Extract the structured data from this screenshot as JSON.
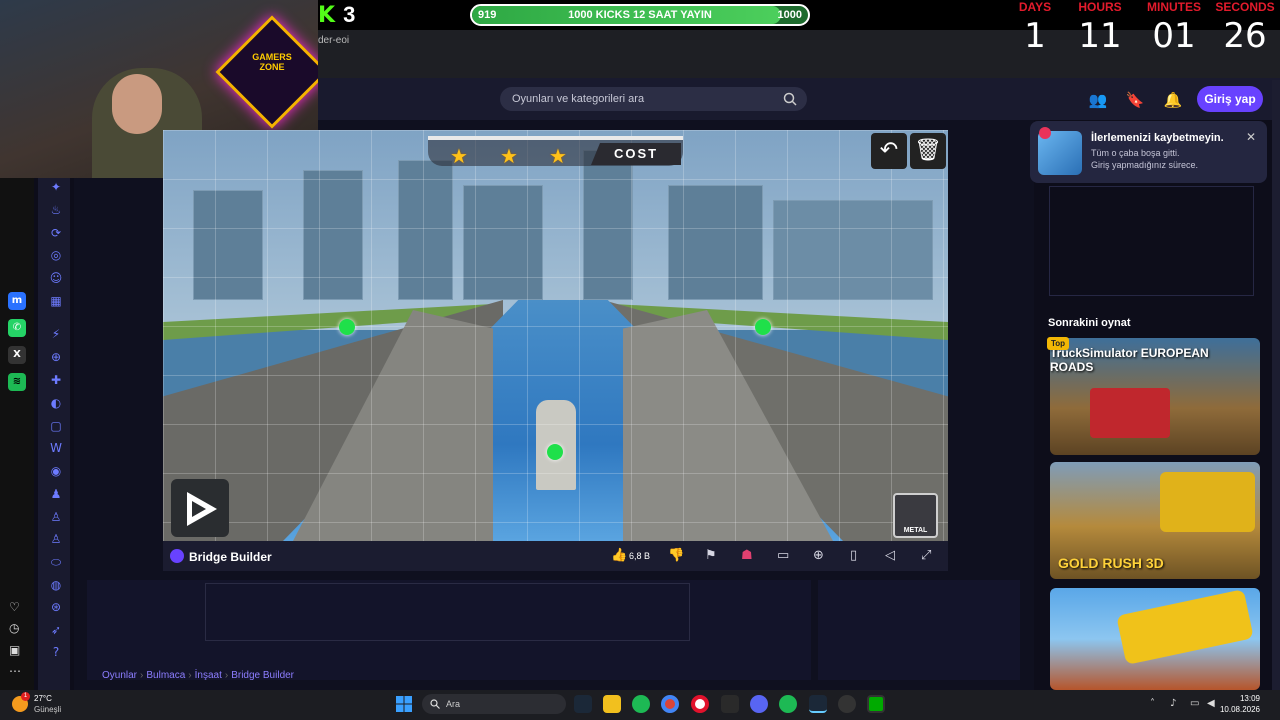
{
  "stream": {
    "kick_count": "3",
    "goal": {
      "current": "919",
      "title": "1000 KICKS 12 SAAT YAYIN",
      "max": "1000",
      "progress": 0.919
    },
    "countdown": {
      "days_label": "DAYS",
      "days": "1",
      "hours_label": "HOURS",
      "hours": "11",
      "minutes_label": "MINUTES",
      "minutes": "01",
      "seconds_label": "SECONDS",
      "seconds": "26"
    },
    "url_fragment": "der-eoi",
    "logo_text": "GAMERS ZONE"
  },
  "header": {
    "search_placeholder": "Oyunları ve kategorileri ara",
    "login_label": "Giriş yap"
  },
  "game": {
    "title": "Bridge Builder",
    "cost_label": "COST",
    "stars": 3,
    "material_label": "METAL",
    "like_count": "6,8 B"
  },
  "breadcrumb": [
    "Oyunlar",
    "Bulmaca",
    "İnşaat",
    "Bridge Builder"
  ],
  "notification": {
    "title": "İlerlemenizi kaybetmeyin.",
    "line1": "Tüm o çaba boşa gitti.",
    "line2": "Giriş yapmadığınız sürece."
  },
  "next": {
    "title": "Sonrakini oynat",
    "badge": "Top",
    "cards": [
      {
        "label": "TruckSimulator EUROPEAN ROADS"
      },
      {
        "label": "GOLD RUSH 3D"
      },
      {
        "label": ""
      }
    ]
  },
  "taskbar": {
    "temperature": "27°C",
    "weather": "Güneşli",
    "weather_badge": "1",
    "search_label": "Ara",
    "time": "13:09",
    "date": "10.08.2026"
  },
  "colors": {
    "accent": "#6842ff",
    "kick_green": "#53fc18",
    "countdown_red": "#e21b2c"
  }
}
